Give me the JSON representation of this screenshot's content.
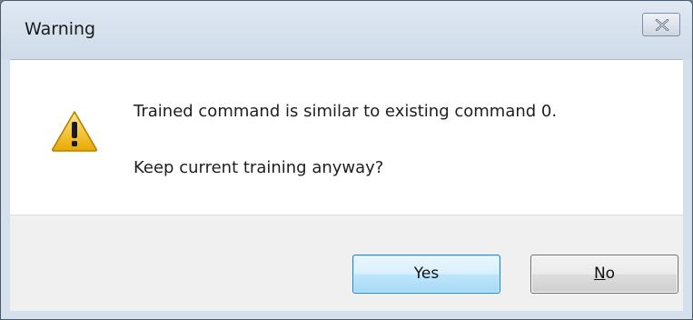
{
  "window": {
    "title": "Warning",
    "close_icon": "close-icon"
  },
  "message": {
    "icon": "warning-icon",
    "line1": "Trained command is similar to existing command 0.",
    "line2": "Keep current training anyway?"
  },
  "buttons": {
    "yes_label": "Yes",
    "no_mnemonic": "N",
    "no_rest": "o"
  },
  "colors": {
    "warning_fill": "#f4c430",
    "default_button_border": "#3c7fb1"
  }
}
